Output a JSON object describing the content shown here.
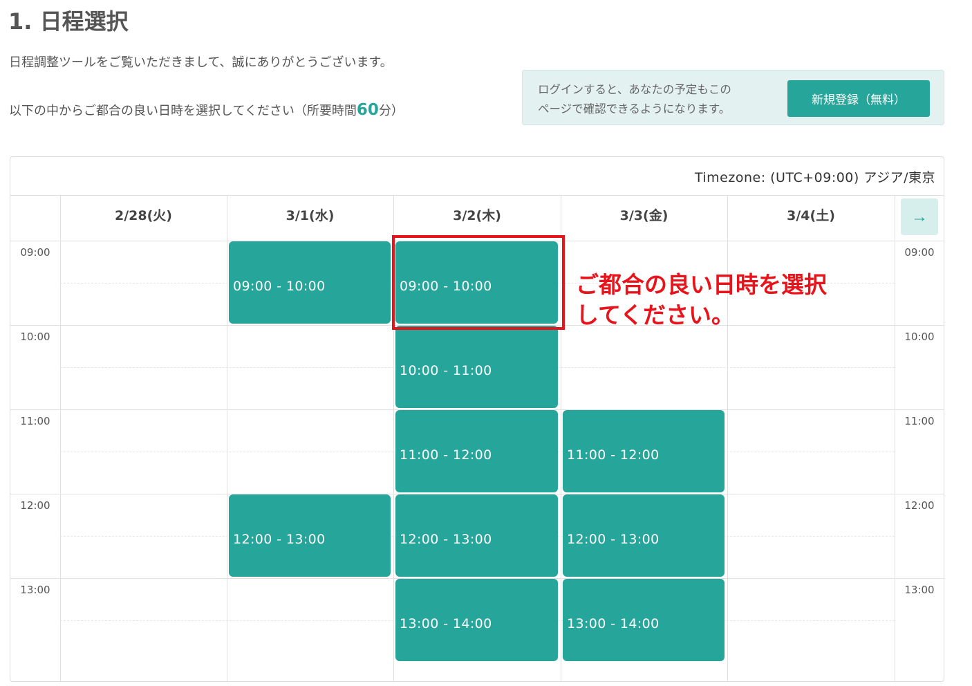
{
  "heading": "1. 日程選択",
  "intro": "日程調整ツールをご覧いただきまして、誠にありがとうございます。",
  "instruction": {
    "prefix": "以下の中からご都合の良い日時を選択してください（所要時間",
    "duration": "60",
    "suffix": "分）"
  },
  "login_box": {
    "line1": "ログインすると、あなたの予定もこの",
    "line2": "ページで確認できるようになります。",
    "register_label": "新規登録（無料）"
  },
  "calendar": {
    "timezone": "Timezone: (UTC+09:00) アジア/東京",
    "days": [
      "2/28(火)",
      "3/1(水)",
      "3/2(木)",
      "3/3(金)",
      "3/4(土)"
    ],
    "times": [
      "09:00",
      "10:00",
      "11:00",
      "12:00",
      "13:00"
    ],
    "next_icon": "arrow-right-icon",
    "slots": [
      {
        "day": 1,
        "row": 0,
        "label": "09:00 - 10:00"
      },
      {
        "day": 2,
        "row": 0,
        "label": "09:00 - 10:00"
      },
      {
        "day": 2,
        "row": 1,
        "label": "10:00 - 11:00"
      },
      {
        "day": 2,
        "row": 2,
        "label": "11:00 - 12:00"
      },
      {
        "day": 3,
        "row": 2,
        "label": "11:00 - 12:00"
      },
      {
        "day": 1,
        "row": 3,
        "label": "12:00 - 13:00"
      },
      {
        "day": 2,
        "row": 3,
        "label": "12:00 - 13:00"
      },
      {
        "day": 3,
        "row": 3,
        "label": "12:00 - 13:00"
      },
      {
        "day": 2,
        "row": 4,
        "label": "13:00 - 14:00"
      },
      {
        "day": 3,
        "row": 4,
        "label": "13:00 - 14:00"
      }
    ]
  },
  "annotation": {
    "line1": "ご都合の良い日時を選択",
    "line2": "してください。"
  },
  "colors": {
    "accent": "#26a69a",
    "annotation": "#e8141b",
    "login_bg": "#e3f2f1"
  }
}
